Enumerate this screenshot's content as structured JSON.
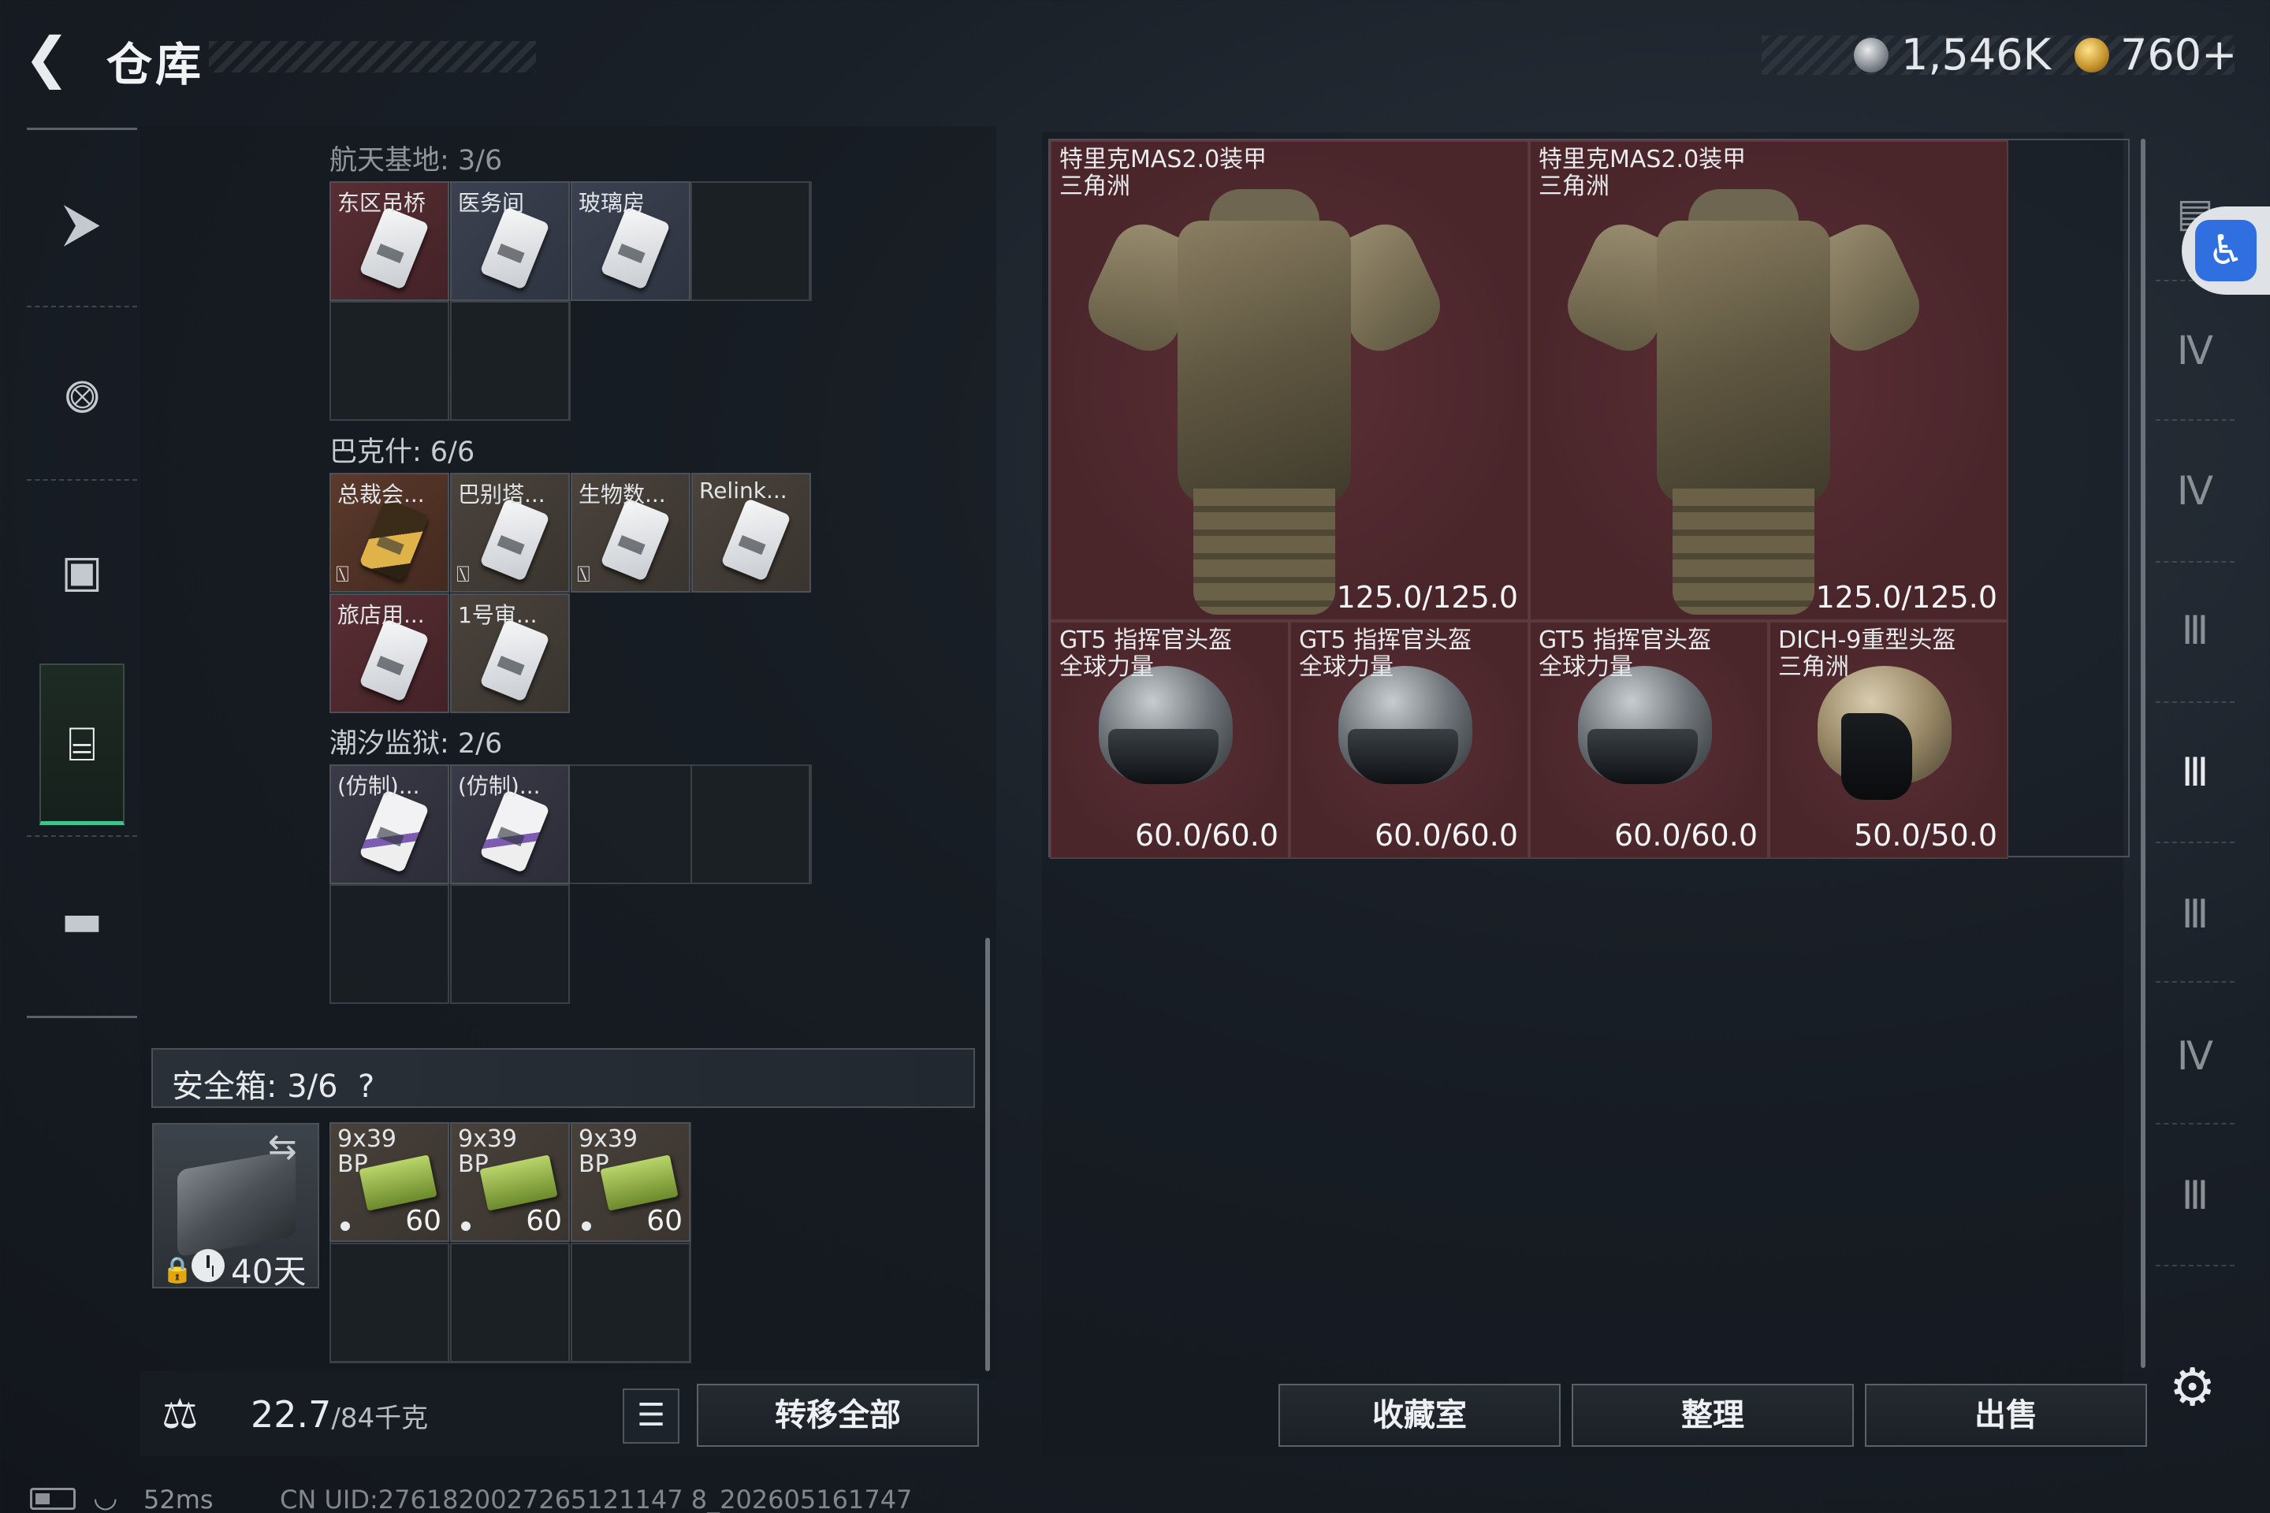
{
  "header": {
    "back_icon": "back-arrow-icon",
    "title": "仓库",
    "currency1_value": "1,546K",
    "currency1_icon": "silver-coin-icon",
    "currency2_value": "760+",
    "currency2_icon": "gold-coin-icon"
  },
  "left_nav": [
    "pistol-icon",
    "vest-icon",
    "backpack-icon",
    "storage-icon",
    "briefcase-icon"
  ],
  "sections": [
    {
      "title": "航天基地: 3/6",
      "items": [
        "东区吊桥",
        "医务间",
        "玻璃房"
      ]
    },
    {
      "title": "巴克什: 6/6",
      "items": [
        "总裁会...",
        "巴别塔...",
        "生物数...",
        "Relink...",
        "旅店用...",
        "1号审..."
      ]
    },
    {
      "title": "潮汐监狱: 2/6",
      "items": [
        "(仿制)...",
        "(仿制)..."
      ]
    }
  ],
  "safebox": {
    "title": "安全箱: 3/6",
    "help": "?",
    "days": "40天",
    "ammo_label": "9x39\nBP",
    "ammo_qty": "60"
  },
  "weight": {
    "current": "22.7",
    "capacity": "/84千克"
  },
  "buttons": {
    "transfer_all": "转移全部",
    "collection": "收藏室",
    "organize": "整理",
    "sell": "出售"
  },
  "armor": [
    {
      "name": "特里克MAS2.0装甲",
      "origin": "三角洲",
      "durability": "125.0/125.0"
    },
    {
      "name": "特里克MAS2.0装甲",
      "origin": "三角洲",
      "durability": "125.0/125.0"
    }
  ],
  "helmets": [
    {
      "name": "GT5 指挥官头盔",
      "origin": "全球力量",
      "durability": "60.0/60.0"
    },
    {
      "name": "GT5 指挥官头盔",
      "origin": "全球力量",
      "durability": "60.0/60.0"
    },
    {
      "name": "GT5 指挥官头盔",
      "origin": "全球力量",
      "durability": "60.0/60.0"
    },
    {
      "name": "DICH-9重型头盔",
      "origin": "三角洲",
      "durability": "50.0/50.0"
    }
  ],
  "status": {
    "ping": "52ms",
    "uid": "CN UID:2761820027265121147 8_202605161747"
  }
}
